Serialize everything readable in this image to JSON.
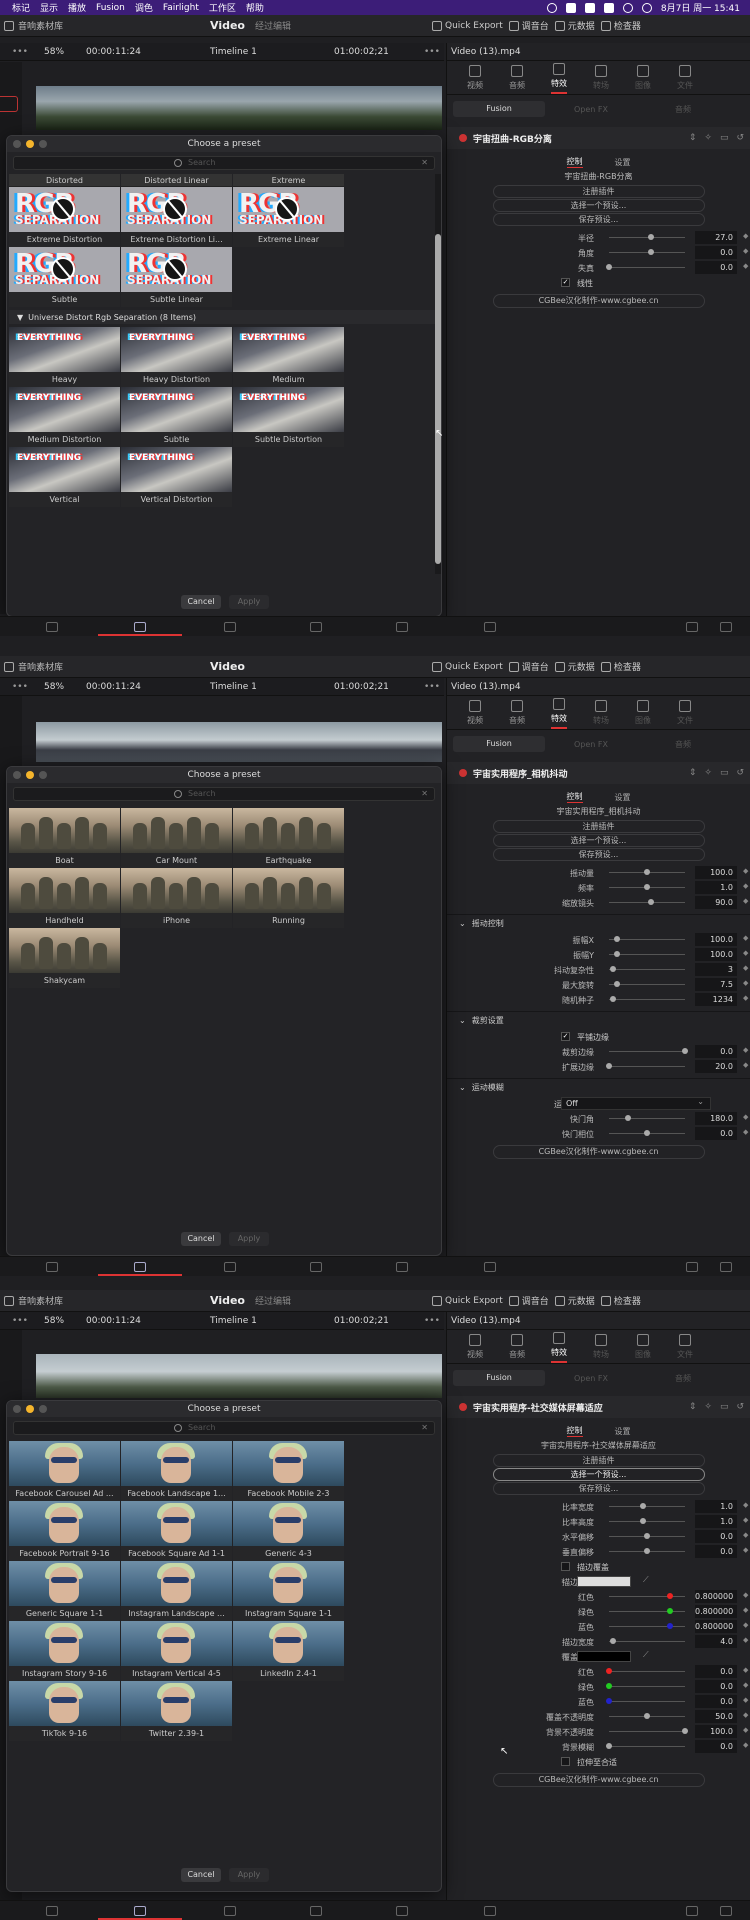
{
  "menubar": {
    "items": [
      "标记",
      "显示",
      "播放",
      "Fusion",
      "调色",
      "Fairlight",
      "工作区",
      "帮助"
    ],
    "clock": "8月7日 周一 15:41"
  },
  "topbar": {
    "media_pool": "音响素材库",
    "title": "Video",
    "subtitle": "经过编辑",
    "quick_export": "Quick Export",
    "color_panel": "调音台",
    "metadata": "元数据",
    "inspector": "检查器"
  },
  "timeline_bar": {
    "zoom": "58%",
    "timecode_in": "00:00:11:24",
    "timeline": "Timeline 1",
    "timecode_out": "01:00:02;21"
  },
  "inspector": {
    "clip": "Video (13).mp4",
    "tabs": [
      "视频",
      "音频",
      "特效",
      "转场",
      "图像",
      "文件"
    ],
    "subtabs": [
      "Fusion",
      "Open FX",
      "音频"
    ],
    "ctrl_tabs": [
      "控制",
      "设置"
    ],
    "register": "注册插件",
    "choose_preset": "选择一个预设...",
    "save_preset": "保存预设...",
    "credit": "CGBee汉化制作-www.cgbee.cn"
  },
  "dialog": {
    "title": "Choose a preset",
    "search_placeholder": "Search",
    "cancel": "Cancel",
    "apply": "Apply"
  },
  "panel1": {
    "fx_name": "宇宙扭曲-RGB分离",
    "fx_subtitle": "宇宙扭曲-RGB分离",
    "params": [
      {
        "label": "半径",
        "value": "27.0",
        "pos": 0.55
      },
      {
        "label": "角度",
        "value": "0.0",
        "pos": 0.55
      },
      {
        "label": "失真",
        "value": "0.0",
        "pos": 0.0
      }
    ],
    "checkbox_label": "线性",
    "presets_top": [
      {
        "header": "Distorted",
        "caption": "Extreme Distortion"
      },
      {
        "header": "Distorted Linear",
        "caption": "Extreme Distortion Li..."
      },
      {
        "header": "Extreme",
        "caption": "Extreme Linear"
      },
      {
        "header": "",
        "caption": "Subtle"
      },
      {
        "header": "",
        "caption": "Subtle Linear"
      }
    ],
    "group_label": "Universe Distort Rgb Separation (8 Items)",
    "presets_group": [
      "Heavy",
      "Heavy Distortion",
      "Medium",
      "Medium Distortion",
      "Subtle",
      "Subtle Distortion",
      "Vertical",
      "Vertical Distortion"
    ],
    "rgb_word": "RGB",
    "rgb_word2": "SEPARATION",
    "everything_word": "EVERYTHING"
  },
  "panel2": {
    "fx_name": "宇宙实用程序_相机抖动",
    "fx_subtitle": "宇宙实用程序_相机抖动",
    "params_a": [
      {
        "label": "摇动量",
        "value": "100.0",
        "pos": 0.5
      },
      {
        "label": "频率",
        "value": "1.0",
        "pos": 0.5
      },
      {
        "label": "缩放镜头",
        "value": "90.0",
        "pos": 0.55
      }
    ],
    "section_shake": "摇动控制",
    "params_b": [
      {
        "label": "振幅X",
        "value": "100.0",
        "pos": 0.1
      },
      {
        "label": "振幅Y",
        "value": "100.0",
        "pos": 0.1
      },
      {
        "label": "抖动复杂性",
        "value": "3",
        "pos": 0.05
      },
      {
        "label": "最大旋转",
        "value": "7.5",
        "pos": 0.1
      },
      {
        "label": "随机种子",
        "value": "1234",
        "pos": 0.05
      }
    ],
    "section_crop": "裁剪设置",
    "crop_checkbox": "平铺边缘",
    "params_c": [
      {
        "label": "裁剪边缘",
        "value": "0.0",
        "pos": 1.0
      },
      {
        "label": "扩展边缘",
        "value": "20.0",
        "pos": 0.0
      }
    ],
    "section_blur": "运动模糊",
    "blur_quality_label": "运动模糊量",
    "blur_quality_value": "Off",
    "params_d": [
      {
        "label": "快门角",
        "value": "180.0",
        "pos": 0.25
      },
      {
        "label": "快门相位",
        "value": "0.0",
        "pos": 0.5
      }
    ],
    "presets": [
      "Boat",
      "Car Mount",
      "Earthquake",
      "Handheld",
      "iPhone",
      "Running",
      "Shakycam"
    ]
  },
  "panel3": {
    "fx_name": "宇宙实用程序-社交媒体屏幕适应",
    "fx_subtitle": "宇宙实用程序-社交媒体屏幕适应",
    "params_a": [
      {
        "label": "比率宽度",
        "value": "1.0",
        "pos": 0.45
      },
      {
        "label": "比率高度",
        "value": "1.0",
        "pos": 0.45
      },
      {
        "label": "水平偏移",
        "value": "0.0",
        "pos": 0.5
      },
      {
        "label": "垂直偏移",
        "value": "0.0",
        "pos": 0.5
      }
    ],
    "border_overlay": "描边覆盖",
    "border_color_label": "描边颜色",
    "rgb_a": [
      {
        "label": "红色",
        "value": "0.800000",
        "pos": 0.8,
        "dot": "r"
      },
      {
        "label": "绿色",
        "value": "0.800000",
        "pos": 0.8,
        "dot": "g"
      },
      {
        "label": "蓝色",
        "value": "0.800000",
        "pos": 0.8,
        "dot": "b"
      }
    ],
    "border_width": {
      "label": "描边宽度",
      "value": "4.0",
      "pos": 0.05
    },
    "overlay_color_label": "覆盖颜色",
    "rgb_b": [
      {
        "label": "红色",
        "value": "0.0",
        "pos": 0.0,
        "dot": "r"
      },
      {
        "label": "绿色",
        "value": "0.0",
        "pos": 0.0,
        "dot": "g"
      },
      {
        "label": "蓝色",
        "value": "0.0",
        "pos": 0.0,
        "dot": "b"
      }
    ],
    "params_b": [
      {
        "label": "覆盖不透明度",
        "value": "50.0",
        "pos": 0.5
      },
      {
        "label": "背景不透明度",
        "value": "100.0",
        "pos": 1.0
      },
      {
        "label": "背景模糊",
        "value": "0.0",
        "pos": 0.0
      }
    ],
    "stretch_label": "拉伸至合适",
    "presets": [
      "Facebook Carousel Ad ...",
      "Facebook Landscape 1...",
      "Facebook Mobile 2-3",
      "Facebook Portrait 9-16",
      "Facebook Square Ad 1-1",
      "Generic 4-3",
      "Generic Square 1-1",
      "Instagram Landscape ...",
      "Instagram Square 1-1",
      "Instagram Story 9-16",
      "Instagram Vertical 4-5",
      "LinkedIn 2.4-1",
      "TikTok 9-16",
      "Twitter 2.39-1"
    ]
  }
}
